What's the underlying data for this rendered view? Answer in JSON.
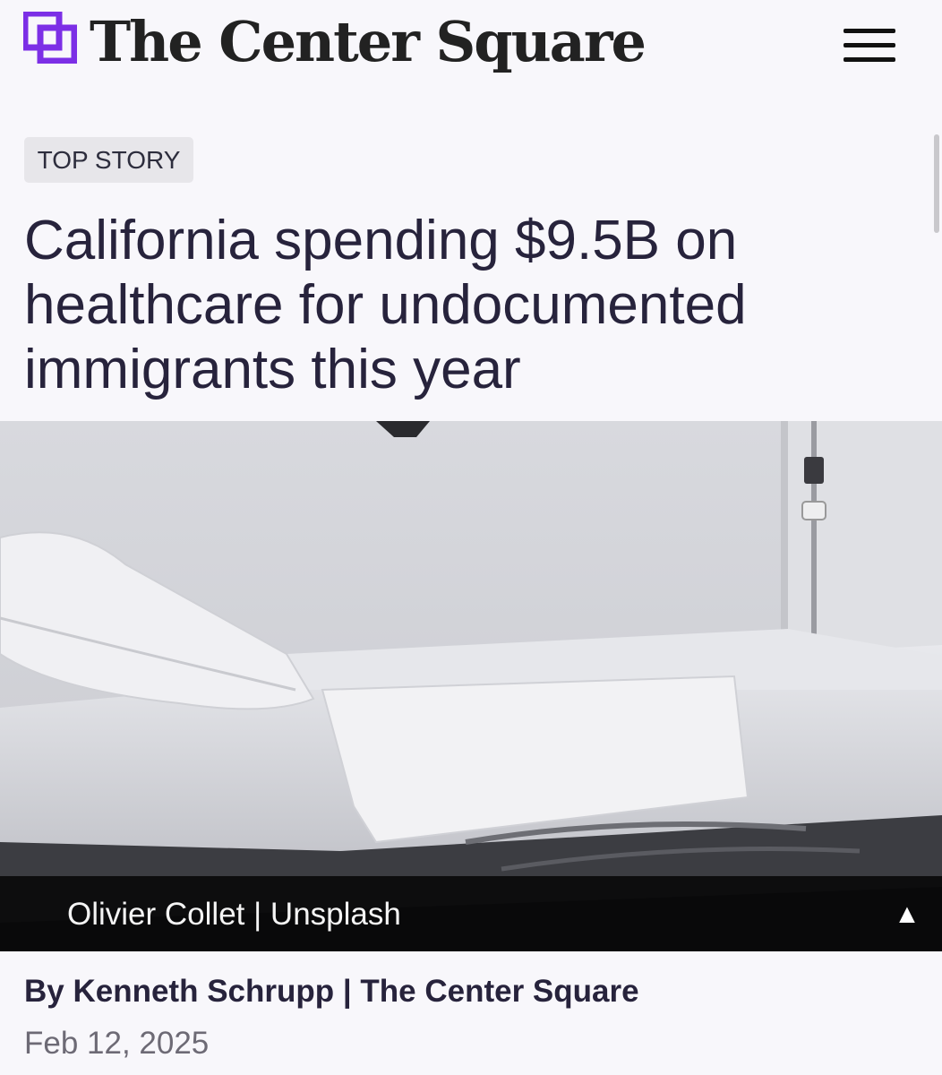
{
  "header": {
    "brand_name": "The Center Square",
    "logo_icon": "overlapping-squares-icon",
    "menu_icon": "hamburger-menu-icon"
  },
  "article": {
    "category_badge": "TOP STORY",
    "headline": "California spending $9.5B on healthcare for undocumented immigrants this year",
    "photo_alt": "Empty hospital bed with white sheets",
    "photo_credit": "Olivier Collet | Unsplash",
    "caption_toggle_icon": "▲",
    "byline": "By Kenneth Schrupp | The Center Square",
    "date": "Feb 12, 2025"
  },
  "colors": {
    "brand_purple": "#7c2fe6",
    "text_dark": "#27233c",
    "background": "#f8f7fb",
    "badge_bg": "#e7e6ea",
    "date_gray": "#6d6a75"
  }
}
